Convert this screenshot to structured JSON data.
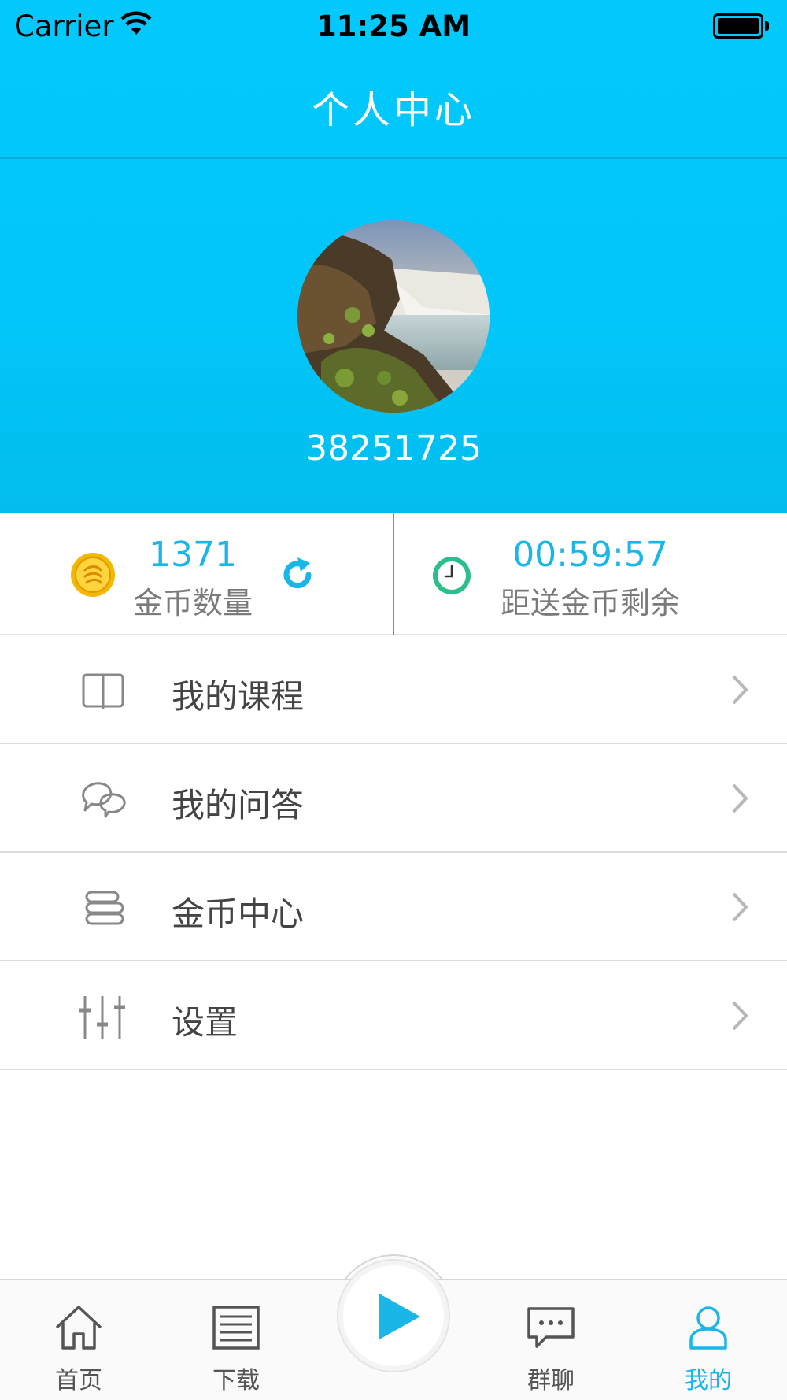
{
  "status_bar": {
    "carrier": "Carrier",
    "time": "11:25 AM"
  },
  "nav": {
    "title": "个人中心"
  },
  "profile": {
    "user_id": "38251725"
  },
  "stats": {
    "coins": {
      "value": "1371",
      "label": "金币数量"
    },
    "timer": {
      "value": "00:59:57",
      "label": "距送金币剩余"
    }
  },
  "menu": {
    "items": [
      {
        "label": "我的课程",
        "icon": "book-icon"
      },
      {
        "label": "我的问答",
        "icon": "chat-bubbles-icon"
      },
      {
        "label": "金币中心",
        "icon": "coins-stack-icon"
      },
      {
        "label": "设置",
        "icon": "sliders-icon"
      }
    ]
  },
  "tabbar": {
    "tabs": [
      {
        "label": "首页",
        "icon": "home-icon"
      },
      {
        "label": "下载",
        "icon": "list-icon"
      },
      {
        "label": "",
        "icon": "play-icon"
      },
      {
        "label": "群聊",
        "icon": "chat-icon"
      },
      {
        "label": "我的",
        "icon": "user-icon",
        "active": true
      }
    ]
  },
  "colors": {
    "header": "#02c8fb",
    "accent": "#1ab6e8",
    "clock": "#2bbf8a",
    "coin": "#f5b800"
  }
}
